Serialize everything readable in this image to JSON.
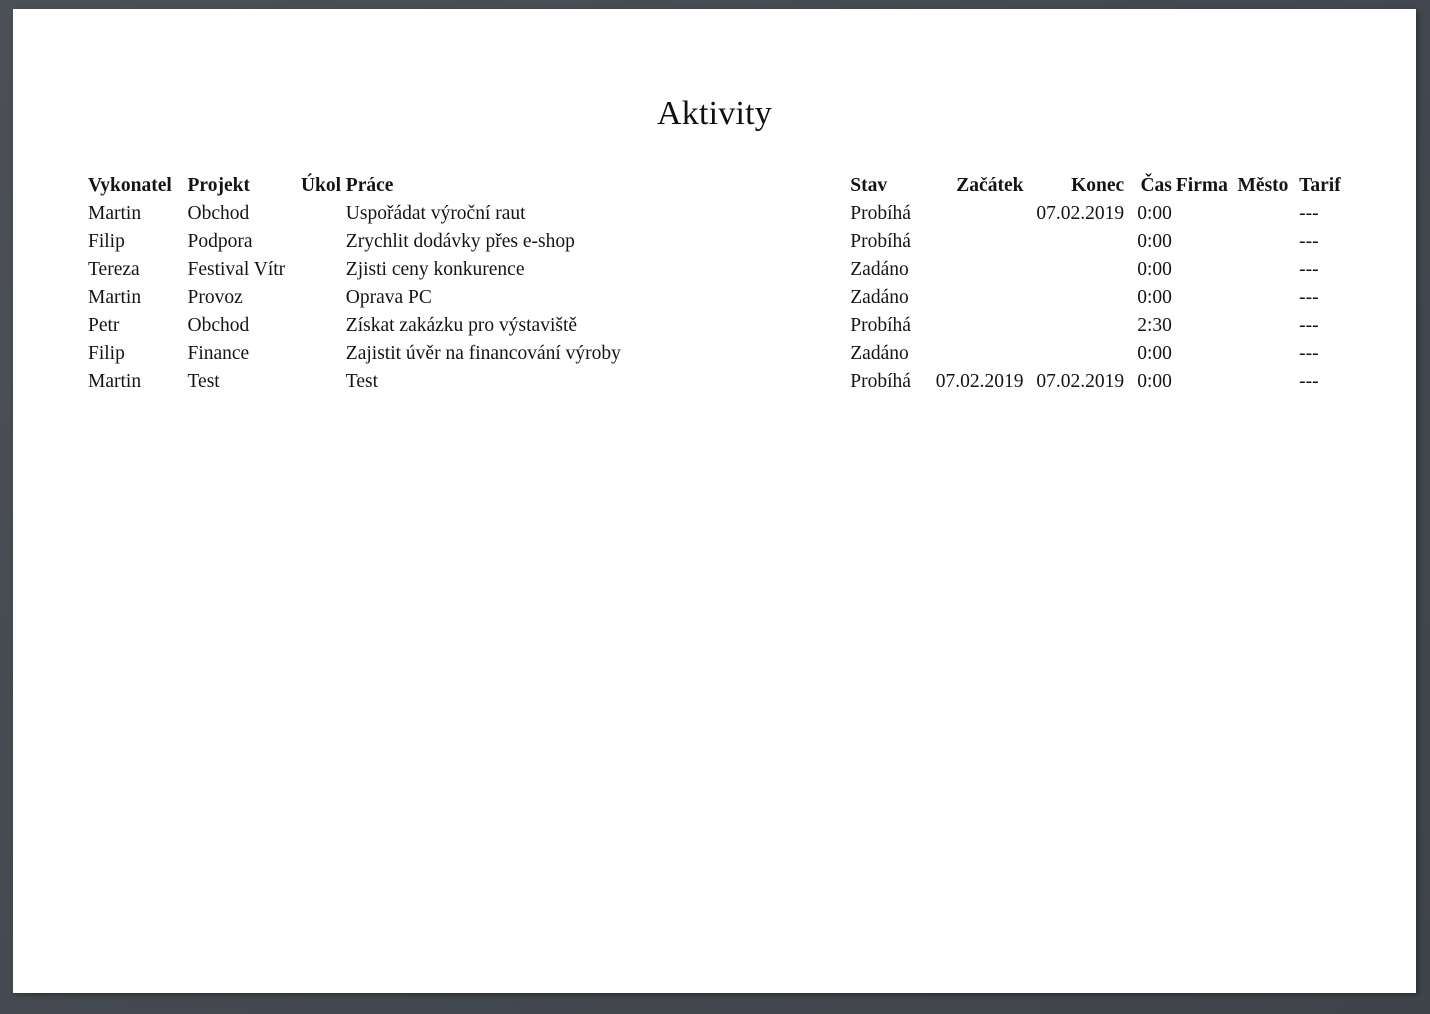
{
  "document": {
    "title": "Aktivity",
    "paper_color": "#ffffff",
    "backdrop_color": "#434850",
    "text_color": "#141414"
  },
  "table": {
    "columns": [
      {
        "key": "vykonatel",
        "label": "Vykonatel"
      },
      {
        "key": "projekt",
        "label": "Projekt"
      },
      {
        "key": "ukol",
        "label": "Úkol"
      },
      {
        "key": "prace",
        "label": "Práce"
      },
      {
        "key": "stav",
        "label": "Stav"
      },
      {
        "key": "zacatek",
        "label": "Začátek"
      },
      {
        "key": "konec",
        "label": "Konec"
      },
      {
        "key": "cas",
        "label": "Čas"
      },
      {
        "key": "firma",
        "label": "Firma"
      },
      {
        "key": "mesto",
        "label": "Město"
      },
      {
        "key": "tarif",
        "label": "Tarif"
      }
    ],
    "rows": [
      {
        "vykonatel": "Martin",
        "projekt": "Obchod",
        "ukol": "",
        "prace": "Uspořádat výroční raut",
        "stav": "Probíhá",
        "zacatek": "",
        "konec": "07.02.2019",
        "cas": "0:00",
        "firma": "",
        "mesto": "",
        "tarif": "---"
      },
      {
        "vykonatel": "Filip",
        "projekt": "Podpora",
        "ukol": "",
        "prace": "Zrychlit dodávky přes e-shop",
        "stav": "Probíhá",
        "zacatek": "",
        "konec": "",
        "cas": "0:00",
        "firma": "",
        "mesto": "",
        "tarif": "---"
      },
      {
        "vykonatel": "Tereza",
        "projekt": "Festival Vítr",
        "ukol": "",
        "prace": "Zjisti ceny konkurence",
        "stav": "Zadáno",
        "zacatek": "",
        "konec": "",
        "cas": "0:00",
        "firma": "",
        "mesto": "",
        "tarif": "---"
      },
      {
        "vykonatel": "Martin",
        "projekt": "Provoz",
        "ukol": "",
        "prace": "Oprava PC",
        "stav": "Zadáno",
        "zacatek": "",
        "konec": "",
        "cas": "0:00",
        "firma": "",
        "mesto": "",
        "tarif": "---"
      },
      {
        "vykonatel": "Petr",
        "projekt": "Obchod",
        "ukol": "",
        "prace": "Získat zakázku pro výstaviště",
        "stav": "Probíhá",
        "zacatek": "",
        "konec": "",
        "cas": "2:30",
        "firma": "",
        "mesto": "",
        "tarif": "---"
      },
      {
        "vykonatel": "Filip",
        "projekt": "Finance",
        "ukol": "",
        "prace": "Zajistit úvěr na financování výroby",
        "stav": "Zadáno",
        "zacatek": "",
        "konec": "",
        "cas": "0:00",
        "firma": "",
        "mesto": "",
        "tarif": "---"
      },
      {
        "vykonatel": "Martin",
        "projekt": "Test",
        "ukol": "",
        "prace": "Test",
        "stav": "Probíhá",
        "zacatek": "07.02.2019",
        "konec": "07.02.2019",
        "cas": "0:00",
        "firma": "",
        "mesto": "",
        "tarif": "---"
      }
    ]
  }
}
